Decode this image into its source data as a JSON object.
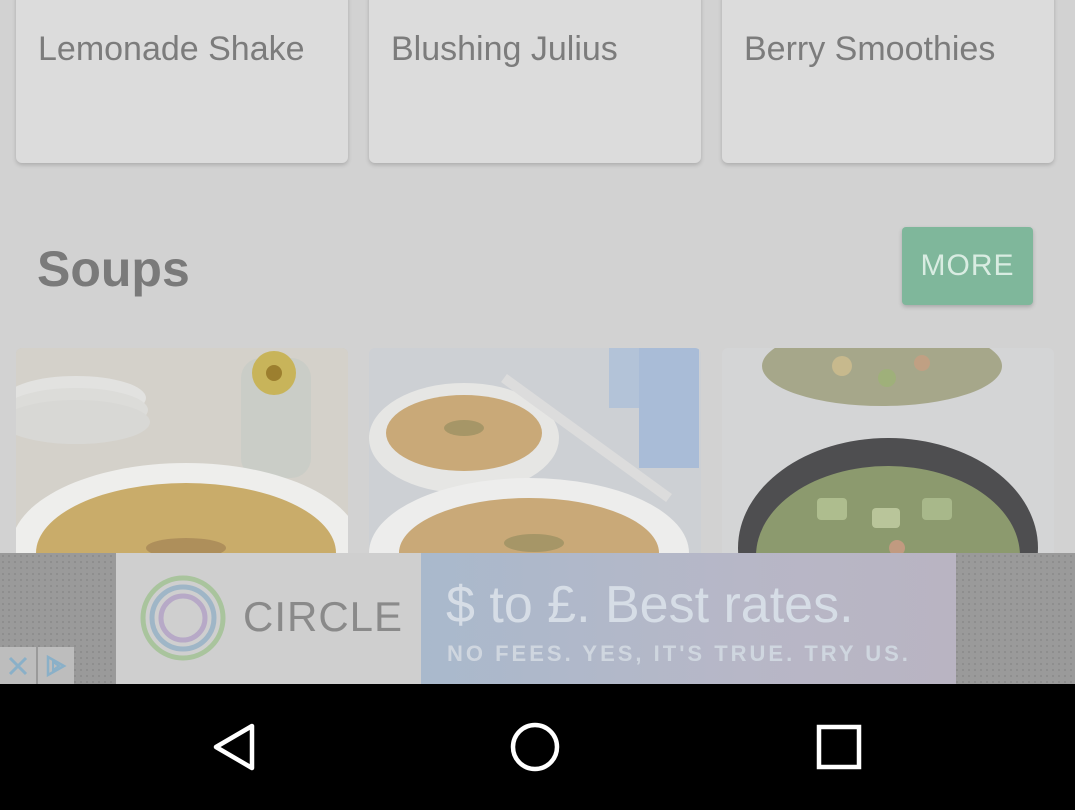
{
  "drinks": {
    "cards": [
      {
        "title": "Lemonade Shake"
      },
      {
        "title": "Blushing Julius"
      },
      {
        "title": "Berry Smoothies"
      }
    ]
  },
  "soups": {
    "title": "Soups",
    "more_label": "MORE",
    "cards": [
      {
        "image": "pumpkin-soup-bowl-photo"
      },
      {
        "image": "carrot-soup-bowls-photo"
      },
      {
        "image": "vegetable-soup-black-bowl-photo"
      }
    ]
  },
  "ad": {
    "brand": "CIRCLE",
    "headline": "$ to £. Best rates.",
    "subline": "NO FEES. YES, IT'S TRUE. TRY US.",
    "close_icon": "close-icon",
    "adchoices_icon": "adchoices-icon"
  },
  "navbar": {
    "back_icon": "back-icon",
    "home_icon": "home-icon",
    "recents_icon": "recents-icon"
  },
  "colors": {
    "accent": "#7fb79b",
    "overlay": "#d2d2d2"
  }
}
